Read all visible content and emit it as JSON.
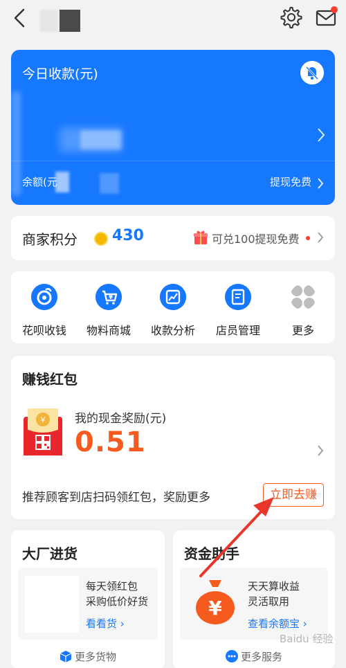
{
  "topbar": {
    "back_icon": "chevron-left-icon",
    "settings_icon": "gear-icon",
    "mail_icon": "mail-icon",
    "notification_color": "#ff3b30"
  },
  "balance_card": {
    "title": "今日收款(元)",
    "mute_icon": "bell-off-icon",
    "balance_label": "余额(元",
    "withdraw_label": "提现免费",
    "color": "#1677ff"
  },
  "points": {
    "label": "商家积分",
    "value": "430",
    "promo": "可兑100提现免费"
  },
  "menu": {
    "items": [
      {
        "label": "花呗收钱",
        "icon": "huabei-icon"
      },
      {
        "label": "物料商城",
        "icon": "shopping-cart-icon"
      },
      {
        "label": "收款分析",
        "icon": "chart-icon"
      },
      {
        "label": "店员管理",
        "icon": "staff-icon"
      },
      {
        "label": "更多",
        "icon": "grid-icon"
      }
    ]
  },
  "red_packet": {
    "title": "赚钱红包",
    "reward_label": "我的现金奖励(元)",
    "reward_value": "0.51",
    "description": "推荐顾客到店扫码领红包，奖励更多",
    "button_label": "立即去赚",
    "accent_color": "#f55b1f"
  },
  "wholesale": {
    "title": "大厂进货",
    "line1": "每天领红包",
    "line2": "采购低价好货",
    "link": "看看货",
    "more": "更多货物"
  },
  "finance": {
    "title": "资金助手",
    "line1": "天天算收益",
    "line2": "灵活取用",
    "link": "查看余额宝",
    "more": "更多服务"
  },
  "watermark": "Baidu 经验"
}
